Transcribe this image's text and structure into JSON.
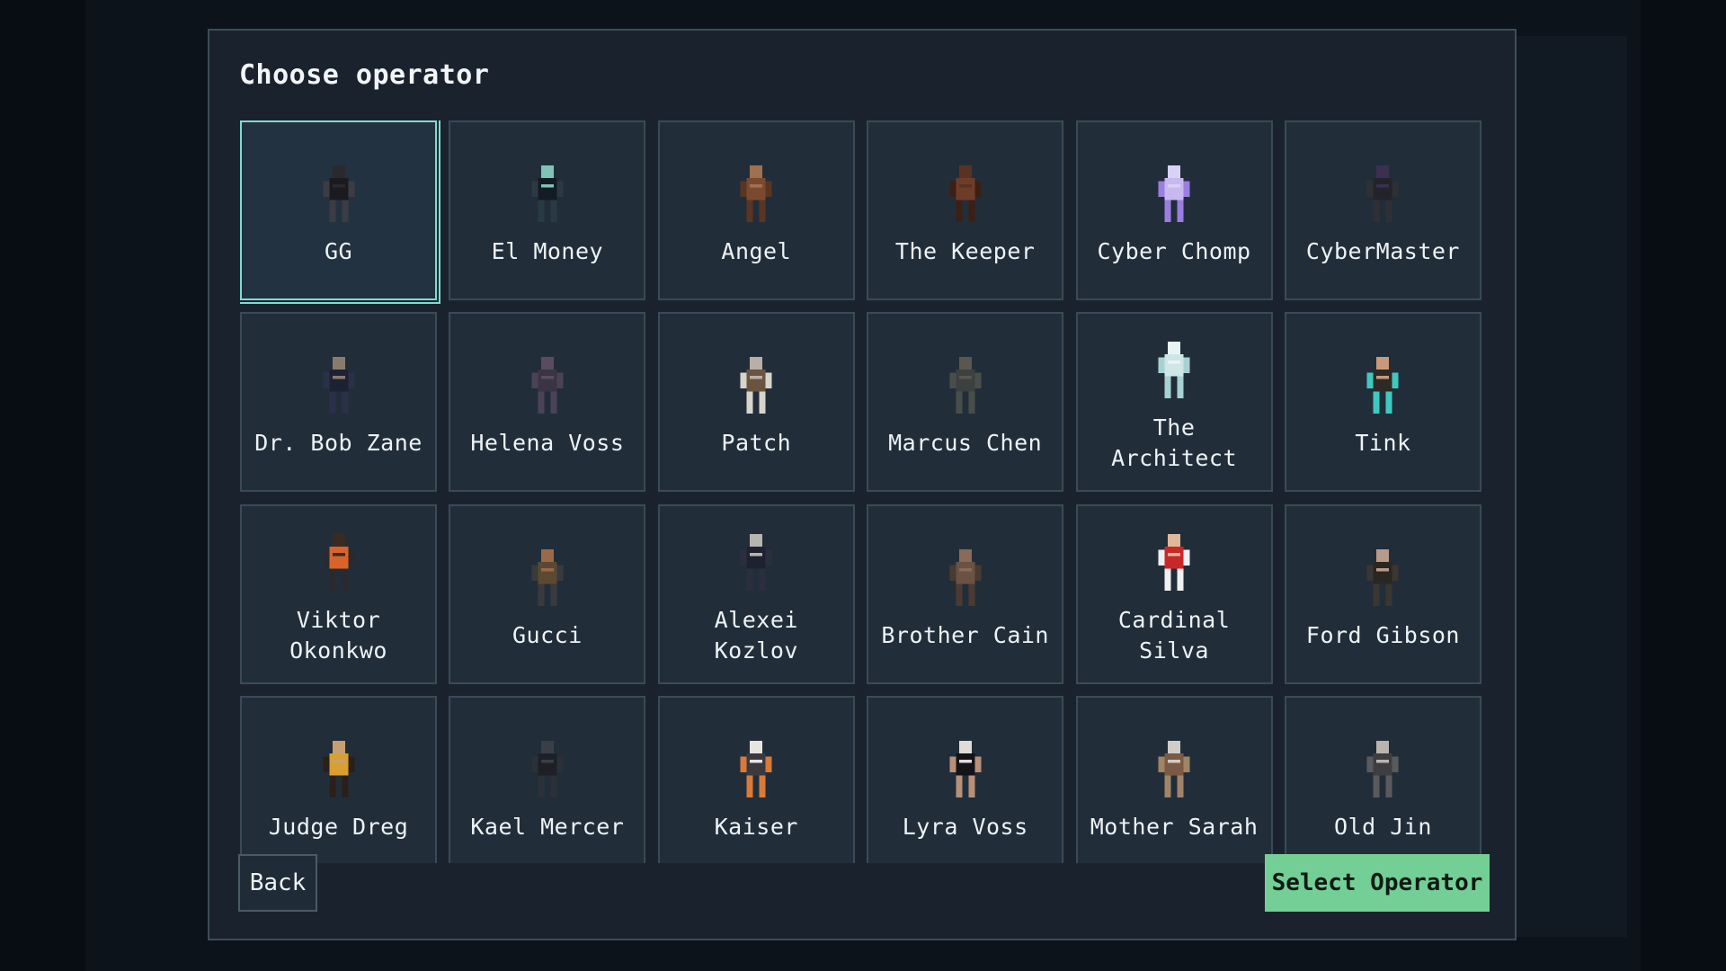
{
  "dialog": {
    "title": "Choose operator",
    "back_label": "Back",
    "select_label": "Select Operator",
    "selected_index": 0
  },
  "operators": [
    {
      "name": "GG",
      "icon": "operator-gg-portrait",
      "palette": {
        "skin": "#2a2a2e",
        "body": "#1b1b1f",
        "accent": "#3c3c44"
      }
    },
    {
      "name": "El Money",
      "icon": "operator-el-money-portrait",
      "palette": {
        "skin": "#7fc4b8",
        "body": "#141b22",
        "accent": "#2a3a44"
      }
    },
    {
      "name": "Angel",
      "icon": "operator-angel-portrait",
      "palette": {
        "skin": "#a0714f",
        "body": "#7a4a30",
        "accent": "#5a3522"
      }
    },
    {
      "name": "The Keeper",
      "icon": "operator-the-keeper-portrait",
      "palette": {
        "skin": "#5a3222",
        "body": "#6e3d27",
        "accent": "#3c2016"
      }
    },
    {
      "name": "Cyber Chomp",
      "icon": "operator-cyber-chomp-portrait",
      "palette": {
        "skin": "#d9d2f5",
        "body": "#c8b8f0",
        "accent": "#9a7ee0"
      }
    },
    {
      "name": "CyberMaster",
      "icon": "operator-cybermaster-portrait",
      "palette": {
        "skin": "#3b2f52",
        "body": "#22242a",
        "accent": "#2e3036"
      }
    },
    {
      "name": "Dr. Bob Zane",
      "icon": "operator-dr-bob-zane-portrait",
      "palette": {
        "skin": "#8a7a6e",
        "body": "#1c2233",
        "accent": "#2a3048"
      }
    },
    {
      "name": "Helena Voss",
      "icon": "operator-helena-voss-portrait",
      "palette": {
        "skin": "#5a4c5e",
        "body": "#3a3444",
        "accent": "#4b4258"
      }
    },
    {
      "name": "Patch",
      "icon": "operator-patch-portrait",
      "palette": {
        "skin": "#b8b0a6",
        "body": "#6a5440",
        "accent": "#d8d4cc"
      }
    },
    {
      "name": "Marcus Chen",
      "icon": "operator-marcus-chen-portrait",
      "palette": {
        "skin": "#5a5650",
        "body": "#3c403e",
        "accent": "#4a4e4a"
      }
    },
    {
      "name": "The Architect",
      "icon": "operator-the-architect-portrait",
      "palette": {
        "skin": "#e8f4f4",
        "body": "#cfe6e6",
        "accent": "#a8d2d2"
      }
    },
    {
      "name": "Tink",
      "icon": "operator-tink-portrait",
      "palette": {
        "skin": "#c89a7a",
        "body": "#2c2a26",
        "accent": "#3fc8c0"
      }
    },
    {
      "name": "Viktor Okonkwo",
      "icon": "operator-viktor-okonkwo-portrait",
      "palette": {
        "skin": "#3a2a22",
        "body": "#d8642a",
        "accent": "#2a2a2e"
      }
    },
    {
      "name": "Gucci",
      "icon": "operator-gucci-portrait",
      "palette": {
        "skin": "#9a6a48",
        "body": "#5a4a32",
        "accent": "#3a3a3e"
      }
    },
    {
      "name": "Alexei Kozlov",
      "icon": "operator-alexei-kozlov-portrait",
      "palette": {
        "skin": "#b8b4b0",
        "body": "#1e2230",
        "accent": "#2a2e3e"
      }
    },
    {
      "name": "Brother Cain",
      "icon": "operator-brother-cain-portrait",
      "palette": {
        "skin": "#8a6a58",
        "body": "#6a5244",
        "accent": "#4a3a32"
      }
    },
    {
      "name": "Cardinal Silva",
      "icon": "operator-cardinal-silva-portrait",
      "palette": {
        "skin": "#e0b898",
        "body": "#c8282a",
        "accent": "#f0f0f0"
      }
    },
    {
      "name": "Ford Gibson",
      "icon": "operator-ford-gibson-portrait",
      "palette": {
        "skin": "#b89a88",
        "body": "#2a2622",
        "accent": "#3a3632"
      }
    },
    {
      "name": "Judge Dreg",
      "icon": "operator-judge-dreg-portrait",
      "palette": {
        "skin": "#c8a070",
        "body": "#d8a030",
        "accent": "#2a2018"
      }
    },
    {
      "name": "Kael Mercer",
      "icon": "operator-kael-mercer-portrait",
      "palette": {
        "skin": "#3a3e48",
        "body": "#1e2026",
        "accent": "#2c3038"
      }
    },
    {
      "name": "Kaiser",
      "icon": "operator-kaiser-portrait",
      "palette": {
        "skin": "#e8e4e0",
        "body": "#3a3a3e",
        "accent": "#d87a3a"
      }
    },
    {
      "name": "Lyra Voss",
      "icon": "operator-lyra-voss-portrait",
      "palette": {
        "skin": "#e0dcd8",
        "body": "#141418",
        "accent": "#b89078"
      }
    },
    {
      "name": "Mother Sarah",
      "icon": "operator-mother-sarah-portrait",
      "palette": {
        "skin": "#d0ccc8",
        "body": "#7a5a42",
        "accent": "#a08468"
      }
    },
    {
      "name": "Old Jin",
      "icon": "operator-old-jin-portrait",
      "palette": {
        "skin": "#b8b4b0",
        "body": "#3e3e40",
        "accent": "#5a5a5c"
      }
    }
  ]
}
